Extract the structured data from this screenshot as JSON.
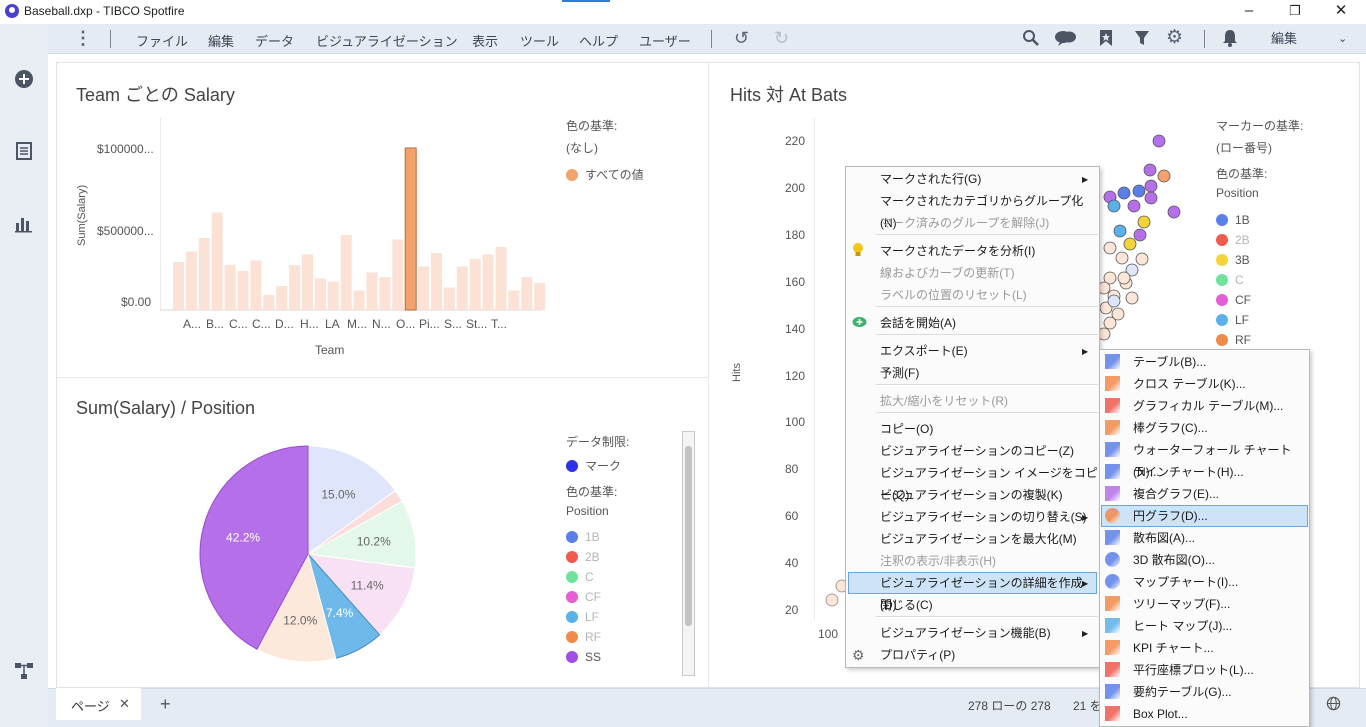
{
  "window": {
    "title": "Baseball.dxp - TIBCO Spotfire"
  },
  "menu": {
    "items": [
      "ファイル",
      "編集",
      "データ",
      "ビジュアライゼーション",
      "表示",
      "ツール",
      "ヘルプ",
      "ユーザー"
    ],
    "mode": "編集"
  },
  "bar_chart": {
    "title": "Team ごとの Salary",
    "legend_title": "色の基準:",
    "legend_none": "(なし)",
    "legend_item": "すべての値",
    "chart_data": {
      "type": "bar",
      "title": "Team ごとの Salary",
      "xlabel": "Team",
      "ylabel": "Sum(Salary)",
      "y_ticks": [
        "$100000...",
        "$500000...",
        "$0.00"
      ],
      "x_tick_labels": [
        "A...",
        "B...",
        "C...",
        "C...",
        "D...",
        "H...",
        "LA",
        "M...",
        "N...",
        "O...",
        "Pi...",
        "S...",
        "St...",
        "T..."
      ],
      "values": [
        0.32,
        0.39,
        0.48,
        0.65,
        0.3,
        0.26,
        0.33,
        0.1,
        0.16,
        0.3,
        0.37,
        0.21,
        0.19,
        0.5,
        0.13,
        0.25,
        0.22,
        0.47,
        1.08,
        0.29,
        0.38,
        0.15,
        0.29,
        0.34,
        0.37,
        0.42,
        0.13,
        0.22,
        0.18,
        0.24
      ],
      "highlight_index": 18,
      "ylim": [
        0,
        1.2
      ]
    }
  },
  "pie_chart": {
    "title": "Sum(Salary) / Position",
    "limit_title": "データ制限:",
    "limit_item": "マーク",
    "legend_title": "色の基準:",
    "legend_sub": "Position",
    "legend": [
      {
        "label": "1B",
        "color": "#5b7fe8",
        "dim": true
      },
      {
        "label": "2B",
        "color": "#ef5a4f",
        "dim": true
      },
      {
        "label": "C",
        "color": "#6fe39b",
        "dim": true
      },
      {
        "label": "CF",
        "color": "#e45fd3",
        "dim": true
      },
      {
        "label": "LF",
        "color": "#5ab1ea",
        "dim": true
      },
      {
        "label": "RF",
        "color": "#f08a4b",
        "dim": true
      },
      {
        "label": "SS",
        "color": "#a24fe0",
        "dim": false
      }
    ],
    "chart_data": {
      "type": "pie",
      "slices": [
        {
          "label": "1B",
          "value": 15.0,
          "text": "15.0%",
          "color": "#dfe5fb"
        },
        {
          "label": "2B",
          "value": 1.9,
          "text": "",
          "color": "#fbdedb"
        },
        {
          "label": "C",
          "value": 10.2,
          "text": "10.2%",
          "color": "#e3f8ea"
        },
        {
          "label": "CF",
          "value": 11.4,
          "text": "11.4%",
          "color": "#f9e1f5"
        },
        {
          "label": "LF",
          "value": 7.4,
          "text": "7.4%",
          "color": "#6fb9ea"
        },
        {
          "label": "RF",
          "value": 12.0,
          "text": "12.0%",
          "color": "#fde8dc"
        },
        {
          "label": "SS",
          "value": 42.2,
          "text": "42.2%",
          "color": "#b56fe8"
        }
      ]
    }
  },
  "scatter": {
    "title": "Hits 対 At Bats",
    "ylabel": "Hits",
    "y_ticks": [
      "220",
      "200",
      "180",
      "160",
      "140",
      "120",
      "100",
      "80",
      "60",
      "40",
      "20"
    ],
    "x_tick_first": "100",
    "marker_title": "マーカーの基準:",
    "marker_sub": "(ロー番号)",
    "color_title": "色の基準:",
    "color_sub": "Position",
    "legend": [
      {
        "label": "1B",
        "color": "#5b7fe8",
        "dim": false
      },
      {
        "label": "2B",
        "color": "#ef5a4f",
        "dim": true
      },
      {
        "label": "3B",
        "color": "#f5d43a",
        "dim": false
      },
      {
        "label": "C",
        "color": "#6fe39b",
        "dim": true
      },
      {
        "label": "CF",
        "color": "#e45fd3",
        "dim": false
      },
      {
        "label": "LF",
        "color": "#5ab1ea",
        "dim": false
      },
      {
        "label": "RF",
        "color": "#f08a4b",
        "dim": false
      }
    ]
  },
  "context_menu": {
    "items": [
      {
        "label": "マークされた行(G)",
        "submenu": true
      },
      {
        "label": "マークされたカテゴリからグループ化(N)"
      },
      {
        "label": "マーク済みのグループを解除(J)",
        "disabled": true
      },
      {
        "label": "マークされたデータを分析(I)",
        "icon": "bulb"
      },
      {
        "label": "線およびカーブの更新(T)",
        "disabled": true
      },
      {
        "label": "ラベルの位置のリセット(L)",
        "disabled": true
      },
      {
        "label": "会話を開始(A)",
        "icon": "chat"
      },
      {
        "label": "エクスポート(E)",
        "submenu": true
      },
      {
        "label": "予測(F)"
      },
      {
        "label": "拡大/縮小をリセット(R)",
        "disabled": true
      },
      {
        "label": "コピー(O)"
      },
      {
        "label": "ビジュアライゼーションのコピー(Z)"
      },
      {
        "label": "ビジュアライゼーション イメージをコピー(Q)"
      },
      {
        "label": "ビジュアライゼーションの複製(K)"
      },
      {
        "label": "ビジュアライゼーションの切り替え(S)",
        "submenu": true
      },
      {
        "label": "ビジュアライゼーションを最大化(M)"
      },
      {
        "label": "注釈の表示/非表示(H)",
        "disabled": true
      },
      {
        "label": "ビジュアライゼーションの詳細を作成(D)",
        "submenu": true,
        "highlight": true
      },
      {
        "label": "閉じる(C)"
      },
      {
        "label": "ビジュアライゼーション機能(B)",
        "submenu": true
      },
      {
        "label": "プロパティ(P)",
        "icon": "gear"
      }
    ]
  },
  "submenu": {
    "items": [
      {
        "label": "テーブル(B)...",
        "icon": "table"
      },
      {
        "label": "クロス テーブル(K)...",
        "icon": "cross-table"
      },
      {
        "label": "グラフィカル テーブル(M)...",
        "icon": "graphical-table"
      },
      {
        "label": "棒グラフ(C)...",
        "icon": "bar-chart"
      },
      {
        "label": "ウォーターフォール チャート(N)...",
        "icon": "waterfall"
      },
      {
        "label": "ラインチャート(H)...",
        "icon": "line-chart"
      },
      {
        "label": "複合グラフ(E)...",
        "icon": "combo-chart"
      },
      {
        "label": "円グラフ(D)...",
        "icon": "pie-chart",
        "highlight": true
      },
      {
        "label": "散布図(A)...",
        "icon": "scatter"
      },
      {
        "label": "3D 散布図(O)...",
        "icon": "scatter-3d"
      },
      {
        "label": "マップチャート(I)...",
        "icon": "map"
      },
      {
        "label": "ツリーマップ(F)...",
        "icon": "treemap"
      },
      {
        "label": "ヒート マップ(J)...",
        "icon": "heatmap"
      },
      {
        "label": "KPI チャート...",
        "icon": "kpi"
      },
      {
        "label": "平行座標プロット(L)...",
        "icon": "parallel"
      },
      {
        "label": "要約テーブル(G)...",
        "icon": "summary"
      },
      {
        "label": "Box Plot...",
        "icon": "boxplot"
      }
    ]
  },
  "bottom": {
    "page_tab": "ページ",
    "add_page": "+",
    "row_count": "278 ローの 278",
    "marked": "21 を"
  }
}
